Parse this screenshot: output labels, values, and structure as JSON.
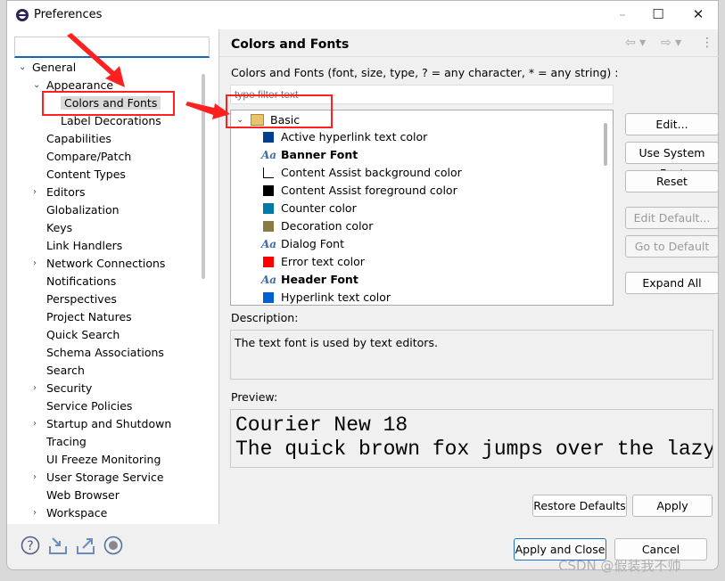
{
  "window": {
    "title": "Preferences",
    "minimize": "–",
    "maximize": "☐",
    "close": "✕"
  },
  "sidebar": {
    "search_placeholder": "",
    "items": [
      {
        "label": "General",
        "expanded": true
      },
      {
        "label": "Appearance",
        "expanded": true
      },
      {
        "label": "Colors and Fonts",
        "selected": true
      },
      {
        "label": "Label Decorations"
      },
      {
        "label": "Capabilities"
      },
      {
        "label": "Compare/Patch"
      },
      {
        "label": "Content Types"
      },
      {
        "label": "Editors",
        "expandable": true
      },
      {
        "label": "Globalization"
      },
      {
        "label": "Keys"
      },
      {
        "label": "Link Handlers"
      },
      {
        "label": "Network Connections",
        "expandable": true
      },
      {
        "label": "Notifications"
      },
      {
        "label": "Perspectives"
      },
      {
        "label": "Project Natures"
      },
      {
        "label": "Quick Search"
      },
      {
        "label": "Schema Associations"
      },
      {
        "label": "Search"
      },
      {
        "label": "Security",
        "expandable": true
      },
      {
        "label": "Service Policies"
      },
      {
        "label": "Startup and Shutdown",
        "expandable": true
      },
      {
        "label": "Tracing"
      },
      {
        "label": "UI Freeze Monitoring"
      },
      {
        "label": "User Storage Service",
        "expandable": true
      },
      {
        "label": "Web Browser"
      },
      {
        "label": "Workspace",
        "expandable": true
      }
    ]
  },
  "main": {
    "title": "Colors and Fonts",
    "filter_label": "Colors and Fonts (font, size, type, ? = any character, * = any string) :",
    "filter_placeholder": "type filter text",
    "category": "Basic",
    "entries": [
      {
        "label": "Active hyperlink text color",
        "type": "color",
        "color": "#003f8f"
      },
      {
        "label": "Banner Font",
        "type": "font",
        "bold": true
      },
      {
        "label": "Content Assist background color",
        "type": "color",
        "color": "#ffffff"
      },
      {
        "label": "Content Assist foreground color",
        "type": "color",
        "color": "#000000"
      },
      {
        "label": "Counter color",
        "type": "color",
        "color": "#0079a8"
      },
      {
        "label": "Decoration color",
        "type": "color",
        "color": "#8c7a44"
      },
      {
        "label": "Dialog Font",
        "type": "font"
      },
      {
        "label": "Error text color",
        "type": "color",
        "color": "#ff0000"
      },
      {
        "label": "Header Font",
        "type": "font",
        "bold": true
      },
      {
        "label": "Hyperlink text color",
        "type": "color",
        "color": "#0060d0"
      }
    ],
    "buttons": {
      "edit": "Edit...",
      "use_system_font": "Use System Font",
      "reset": "Reset",
      "edit_default": "Edit Default...",
      "go_to_default": "Go to Default",
      "expand_all": "Expand All"
    },
    "description_label": "Description:",
    "description": "The text font is used by text editors.",
    "preview_label": "Preview:",
    "preview_line1": "Courier New 18",
    "preview_line2": "The quick brown fox jumps over the lazy dog.",
    "restore_defaults": "Restore Defaults",
    "apply": "Apply"
  },
  "footer": {
    "apply_and_close": "Apply and Close",
    "cancel": "Cancel"
  },
  "watermark": "CSDN @假装我不帅",
  "annotation_color": "#ff2020"
}
